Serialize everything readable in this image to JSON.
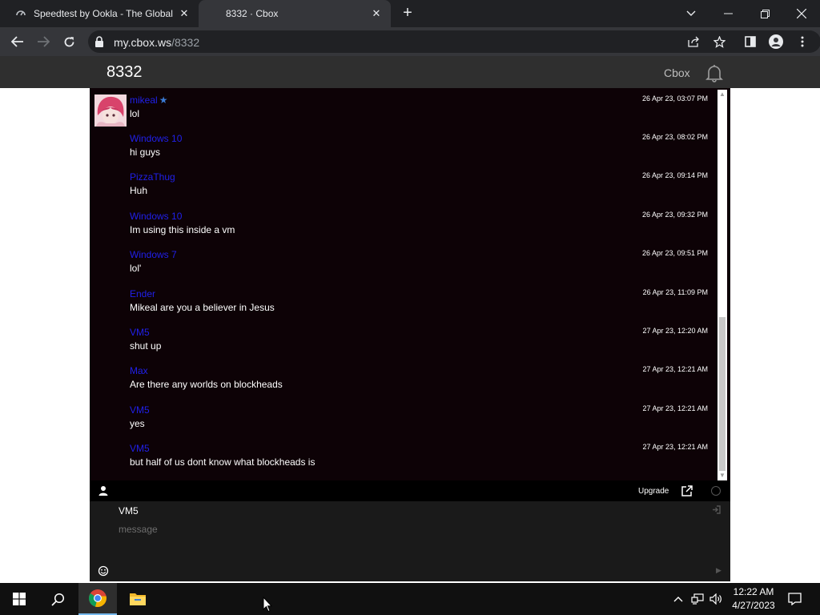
{
  "browser": {
    "tabs": [
      {
        "title": "Speedtest by Ookla - The Global"
      },
      {
        "title": "8332 · Cbox"
      }
    ],
    "url_host": "my.cbox.ws",
    "url_path": "/8332"
  },
  "header": {
    "title": "8332",
    "cbox_link": "Cbox"
  },
  "messages": [
    {
      "user": "mikeal",
      "text": "lol",
      "time": "26 Apr 23, 03:07 PM",
      "has_avatar": true,
      "starred": true
    },
    {
      "user": "Windows 10",
      "text": "hi guys",
      "time": "26 Apr 23, 08:02 PM"
    },
    {
      "user": "PizzaThug",
      "text": "Huh",
      "time": "26 Apr 23, 09:14 PM"
    },
    {
      "user": "Windows 10",
      "text": "Im using this inside a vm",
      "time": "26 Apr 23, 09:32 PM"
    },
    {
      "user": "Windows 7",
      "text": "lol'",
      "time": "26 Apr 23, 09:51 PM"
    },
    {
      "user": "Ender",
      "text": "Mikeal are you a believer in Jesus",
      "time": "26 Apr 23, 11:09 PM"
    },
    {
      "user": "VM5",
      "text": "shut up",
      "time": "27 Apr 23, 12:20 AM"
    },
    {
      "user": "Max",
      "text": "Are there any worlds on blockheads",
      "time": "27 Apr 23, 12:21 AM"
    },
    {
      "user": "VM5",
      "text": "yes",
      "time": "27 Apr 23, 12:21 AM"
    },
    {
      "user": "VM5",
      "text": "but half of us dont know what blockheads is",
      "time": "27 Apr 23, 12:21 AM"
    }
  ],
  "chatbar": {
    "upgrade_label": "Upgrade"
  },
  "compose": {
    "name": "VM5",
    "message_value": "",
    "message_placeholder": "message"
  },
  "taskbar": {
    "time": "12:22 AM",
    "date": "4/27/2023"
  },
  "colors": {
    "username": "#2020e8",
    "chat_background": "#0d0206",
    "header_background": "#2f2f2f"
  },
  "icons": [
    "chrome-globe-icon",
    "cbox-favicon-icon",
    "back-icon",
    "forward-icon",
    "reload-icon",
    "lock-icon",
    "share-icon",
    "star-icon",
    "side-panel-icon",
    "profile-icon",
    "kebab-menu-icon",
    "bell-icon",
    "person-icon",
    "external-link-icon",
    "smile-icon",
    "login-icon",
    "windows-start-icon",
    "search-icon",
    "chrome-icon",
    "file-explorer-icon",
    "network-icon",
    "volume-icon",
    "notification-icon"
  ]
}
